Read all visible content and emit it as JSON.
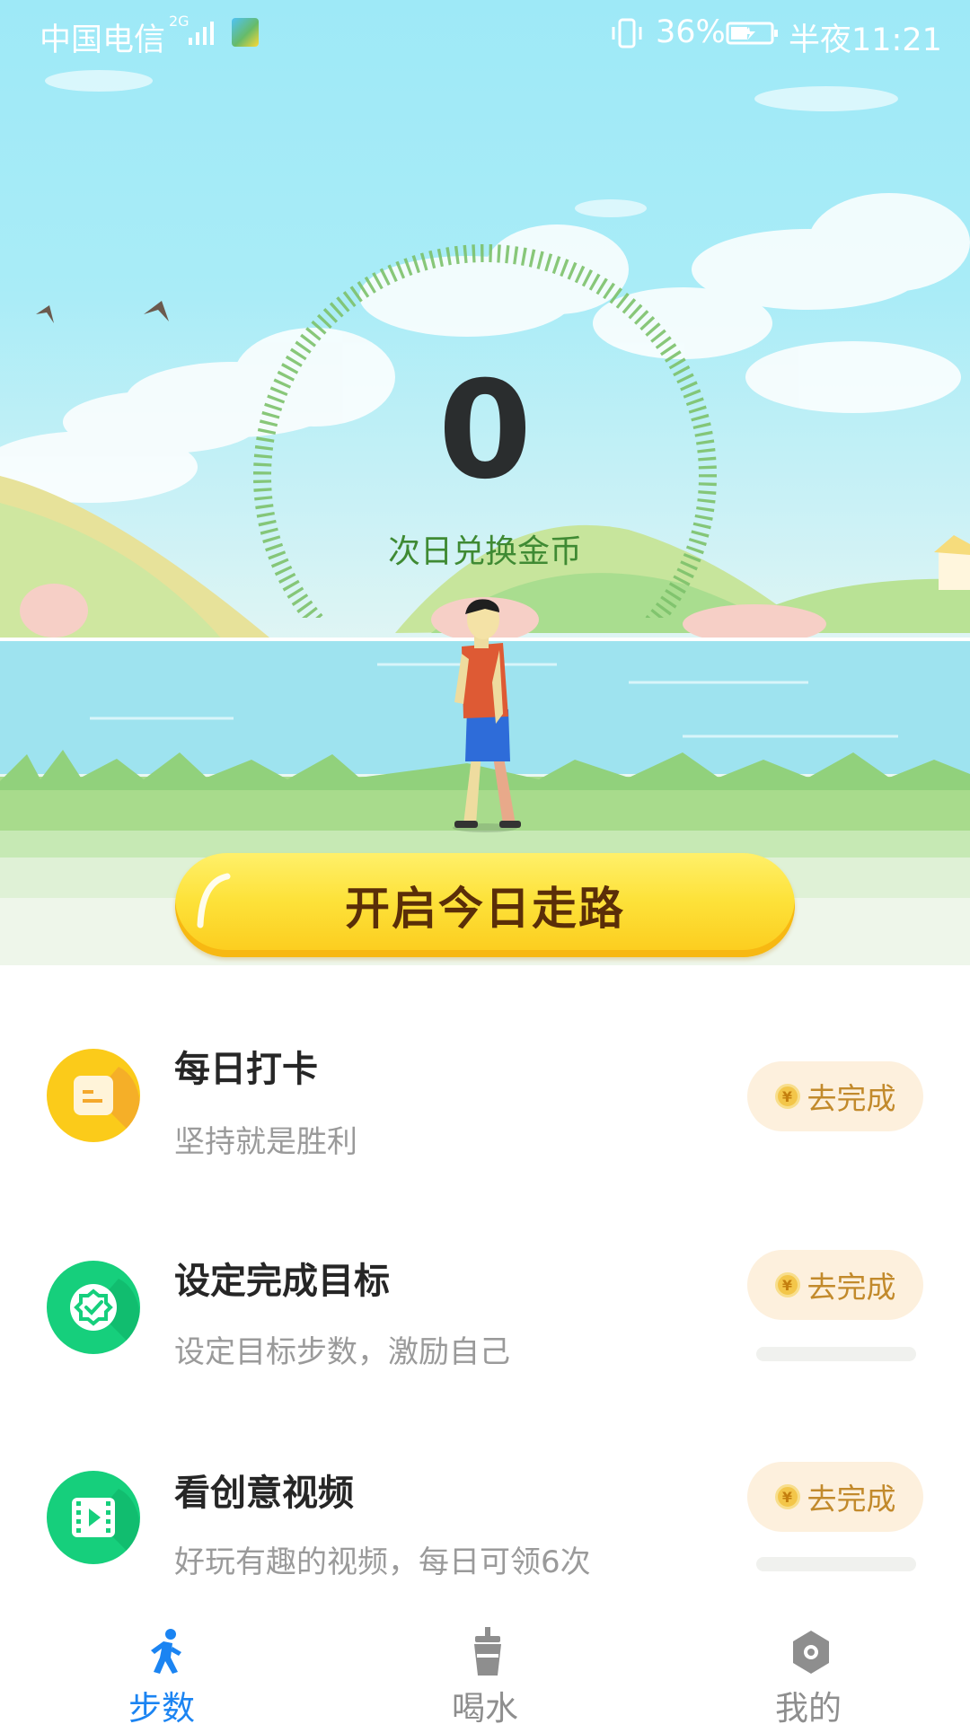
{
  "status_bar": {
    "carrier": "中国电信",
    "network": "2G",
    "battery_percent": "36%",
    "time": "半夜11:21"
  },
  "dial": {
    "count": "0",
    "label": "次日兑换金币"
  },
  "main_button": {
    "label": "开启今日走路"
  },
  "tasks": [
    {
      "title": "每日打卡",
      "subtitle": "坚持就是胜利",
      "button_label": "去完成",
      "icon": "calendar-icon",
      "color": "#fbcb1a"
    },
    {
      "title": "设定完成目标",
      "subtitle": "设定目标步数，激励自己",
      "button_label": "去完成",
      "icon": "target-badge-icon",
      "color": "#16cf7c"
    },
    {
      "title": "看创意视频",
      "subtitle": "好玩有趣的视频，每日可领6次",
      "button_label": "去完成",
      "icon": "video-icon",
      "color": "#16cf7c"
    }
  ],
  "coin_symbol": "¥",
  "bottom_nav": {
    "items": [
      {
        "label": "步数",
        "icon": "walking-person-icon",
        "active": true
      },
      {
        "label": "喝水",
        "icon": "cup-icon",
        "active": false
      },
      {
        "label": "我的",
        "icon": "hexagon-profile-icon",
        "active": false
      }
    ],
    "active_color": "#1b84f2",
    "inactive_color": "#8e8e8e"
  }
}
